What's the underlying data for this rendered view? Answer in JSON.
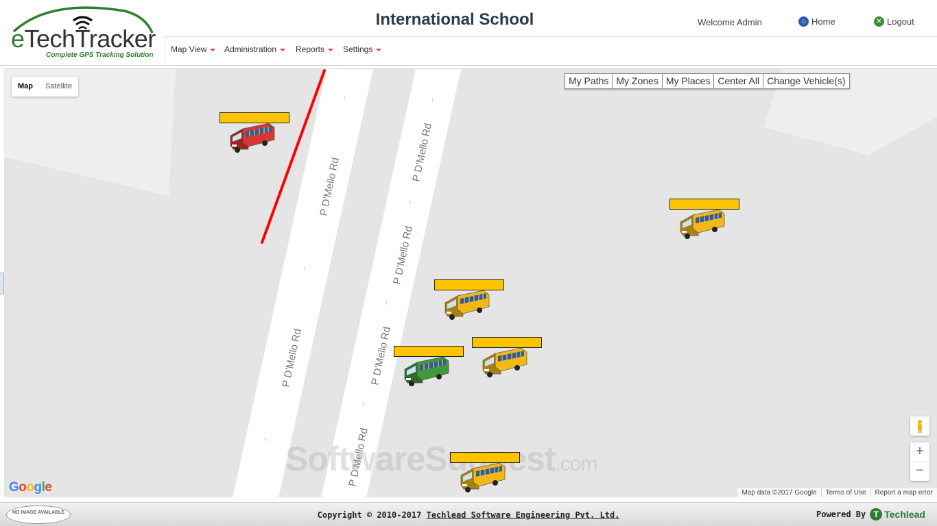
{
  "header": {
    "logo_word_e": "e",
    "logo_word_rest": "TechTracker",
    "logo_tagline": "Complete GPS Tracking Solution",
    "school_name": "International School",
    "welcome": "Welcome Admin",
    "home_label": "Home",
    "logout_label": "Logout"
  },
  "nav": {
    "items": [
      {
        "label": "Map View"
      },
      {
        "label": "Administration"
      },
      {
        "label": "Reports"
      },
      {
        "label": "Settings"
      }
    ]
  },
  "map": {
    "type_controls": {
      "map": "Map",
      "satellite": "Satellite",
      "active": "Map"
    },
    "tools": [
      "My Paths",
      "My Zones",
      "My Places",
      "Center All",
      "Change Vehicle(s)"
    ],
    "road_name": "P D'Mello Rd",
    "path_color": "#ff0000",
    "vehicle_label_color": "#ffc400",
    "vehicles": [
      {
        "type": "bus",
        "color": "#d93636"
      },
      {
        "type": "bus",
        "color": "#f2b818"
      },
      {
        "type": "bus",
        "color": "#f2b818"
      },
      {
        "type": "bus",
        "color": "#3f9a3a"
      },
      {
        "type": "bus",
        "color": "#f2b818"
      },
      {
        "type": "bus",
        "color": "#f2b818"
      }
    ],
    "zoom_in": "+",
    "zoom_out": "−",
    "google_letters": [
      "G",
      "o",
      "o",
      "g",
      "l",
      "e"
    ],
    "attribution": {
      "data": "Map data ©2017 Google",
      "terms": "Terms of Use",
      "report": "Report a map error"
    },
    "watermark": "SoftwareSuggest",
    "watermark_suffix": ".com"
  },
  "footer": {
    "no_image": "NO IMAGE AVAILABLE",
    "copyright_prefix": "Copyright © 2010-2017 ",
    "company": "Techlead Software Engineering Pvt. Ltd.",
    "powered_by": "Powered By",
    "brand": "Techlead",
    "brand_mark": "T"
  }
}
